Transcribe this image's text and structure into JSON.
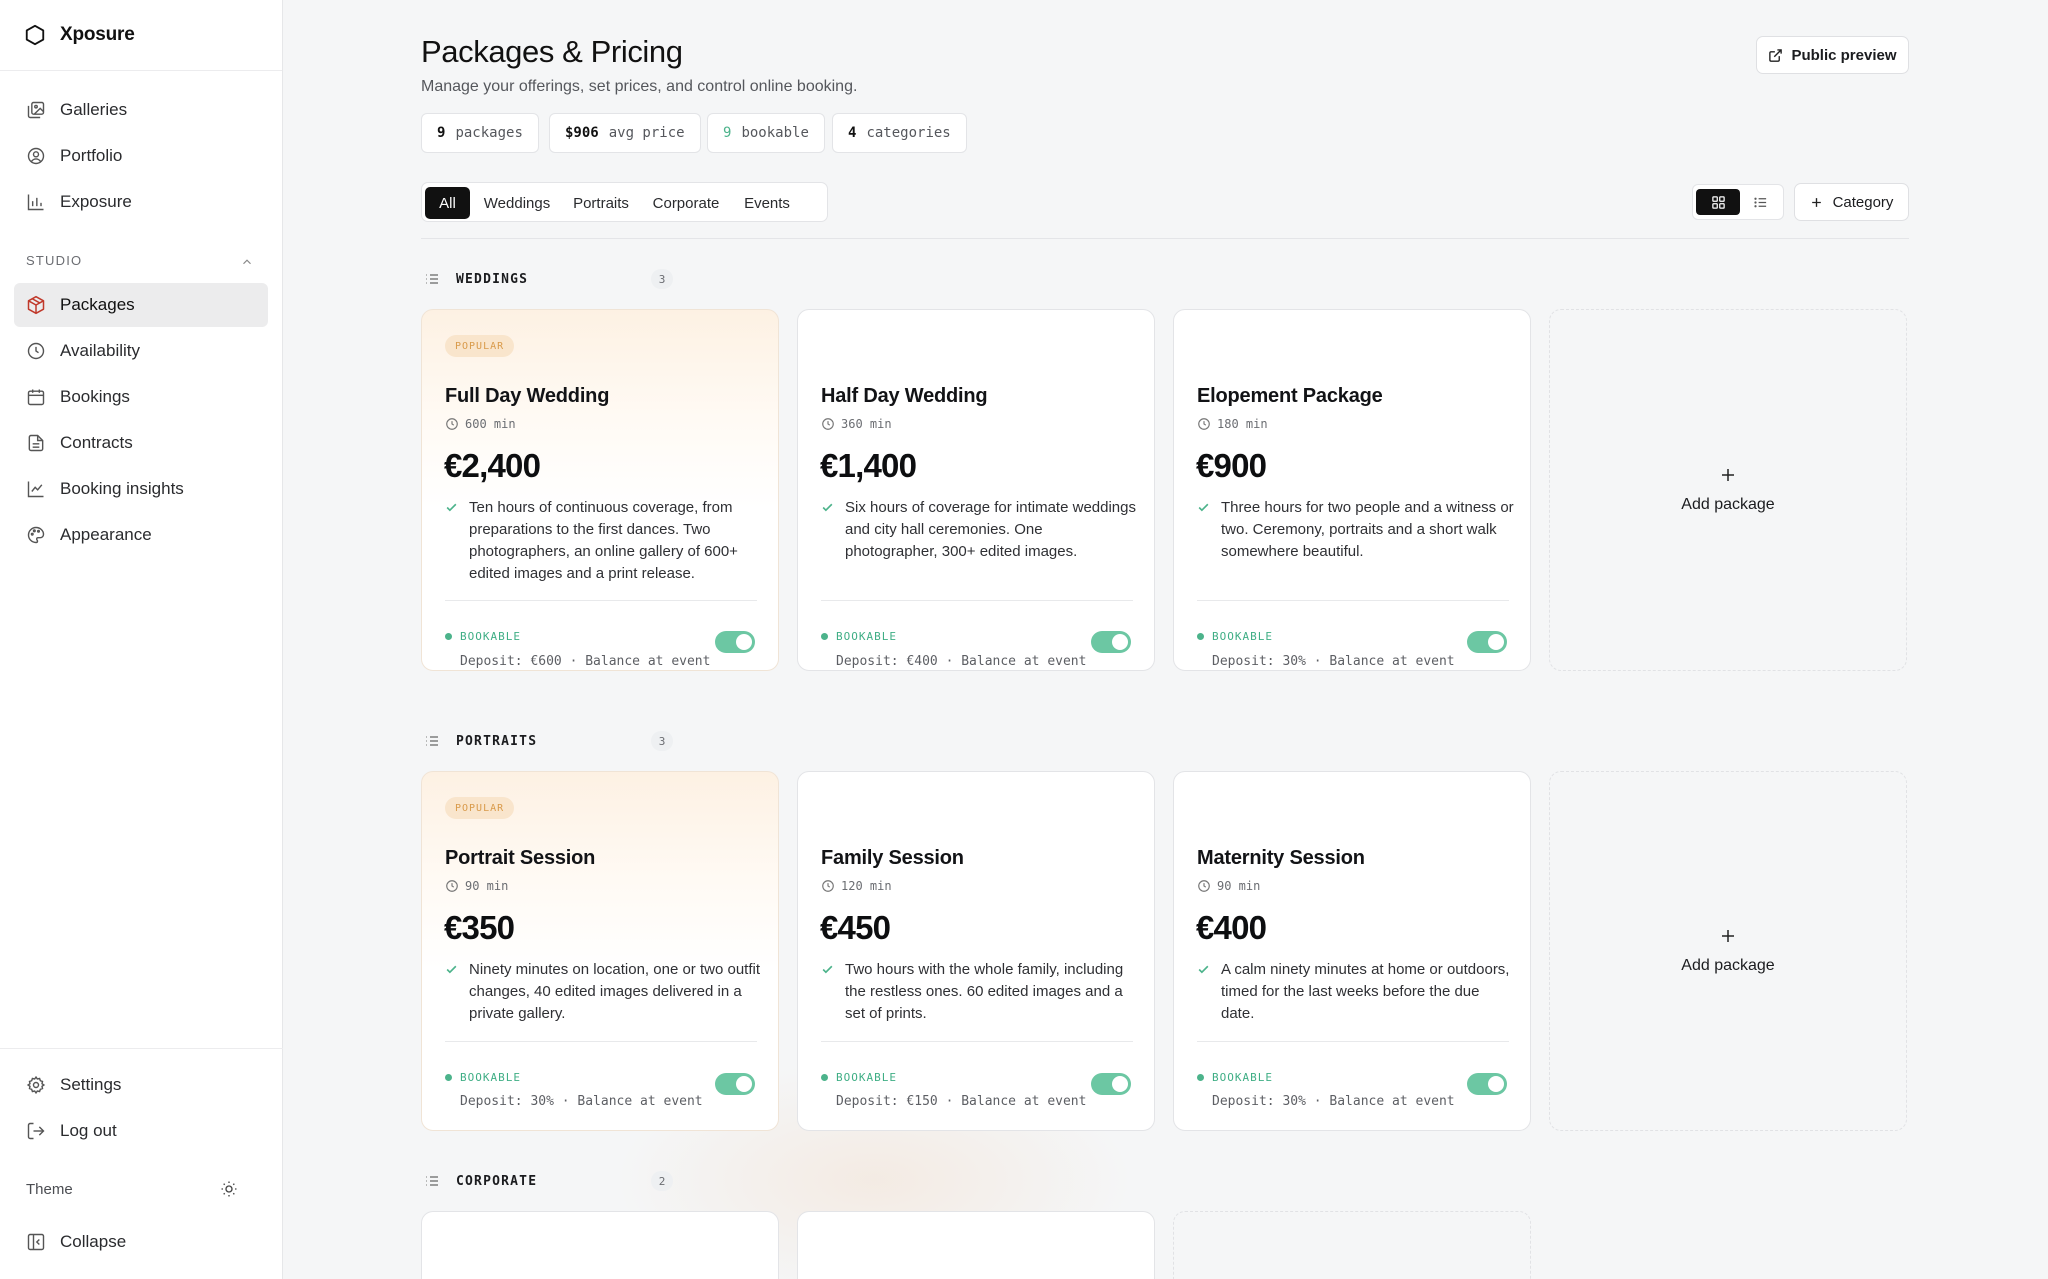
{
  "app": {
    "name": "Xposure"
  },
  "sidebar": {
    "top_items": [
      {
        "label": "Galleries",
        "icon": "gallery-icon"
      },
      {
        "label": "Portfolio",
        "icon": "user-circle-icon"
      },
      {
        "label": "Exposure",
        "icon": "bar-chart-icon"
      }
    ],
    "section_label": "STUDIO",
    "studio_items": [
      {
        "label": "Packages",
        "icon": "package-icon",
        "active": true
      },
      {
        "label": "Availability",
        "icon": "clock-icon"
      },
      {
        "label": "Bookings",
        "icon": "calendar-icon"
      },
      {
        "label": "Contracts",
        "icon": "document-icon"
      },
      {
        "label": "Booking insights",
        "icon": "line-chart-icon"
      },
      {
        "label": "Appearance",
        "icon": "palette-icon"
      }
    ],
    "bottom_items": [
      {
        "label": "Settings",
        "icon": "gear-icon"
      },
      {
        "label": "Log out",
        "icon": "logout-icon"
      }
    ],
    "theme_label": "Theme",
    "collapse_label": "Collapse"
  },
  "header": {
    "title": "Packages & Pricing",
    "subtitle": "Manage your offerings, set prices, and control online booking.",
    "preview_button": "Public preview"
  },
  "stats": [
    {
      "value": "9",
      "label": "packages"
    },
    {
      "value": "$906",
      "label": "avg price"
    },
    {
      "value": "9",
      "label": "bookable"
    },
    {
      "value": "4",
      "label": "categories"
    }
  ],
  "tabs": [
    "All",
    "Weddings",
    "Portraits",
    "Corporate",
    "Events"
  ],
  "active_tab": "All",
  "category_button": "Category",
  "add_package_label": "Add package",
  "colors": {
    "accent_green": "#4cb38b",
    "popular_badge": "#d99a4a",
    "dark": "#111111"
  },
  "categories": [
    {
      "name": "WEDDINGS",
      "count": "3",
      "packages": [
        {
          "badge": "POPULAR",
          "title": "Full Day Wedding",
          "duration": "600 min",
          "price": "€2,400",
          "description": "Ten hours of continuous coverage, from preparations to the first dances. Two photographers, an online gallery of 600+ edited images and a print release.",
          "status": "BOOKABLE",
          "deposit": "Deposit: €600 · Balance at event"
        },
        {
          "badge": "",
          "title": "Half Day Wedding",
          "duration": "360 min",
          "price": "€1,400",
          "description": "Six hours of coverage for intimate weddings and city hall ceremonies. One photographer, 300+ edited images.",
          "status": "BOOKABLE",
          "deposit": "Deposit: €400 · Balance at event"
        },
        {
          "badge": "",
          "title": "Elopement Package",
          "duration": "180 min",
          "price": "€900",
          "description": "Three hours for two people and a witness or two. Ceremony, portraits and a short walk somewhere beautiful.",
          "status": "BOOKABLE",
          "deposit": "Deposit: 30% · Balance at event"
        }
      ]
    },
    {
      "name": "PORTRAITS",
      "count": "3",
      "packages": [
        {
          "badge": "POPULAR",
          "title": "Portrait Session",
          "duration": "90 min",
          "price": "€350",
          "description": "Ninety minutes on location, one or two outfit changes, 40 edited images delivered in a private gallery.",
          "status": "BOOKABLE",
          "deposit": "Deposit: 30% · Balance at event"
        },
        {
          "badge": "",
          "title": "Family Session",
          "duration": "120 min",
          "price": "€450",
          "description": "Two hours with the whole family, including the restless ones. 60 edited images and a set of prints.",
          "status": "BOOKABLE",
          "deposit": "Deposit: €150 · Balance at event"
        },
        {
          "badge": "",
          "title": "Maternity Session",
          "duration": "90 min",
          "price": "€400",
          "description": "A calm ninety minutes at home or outdoors, timed for the last weeks before the due date.",
          "status": "BOOKABLE",
          "deposit": "Deposit: 30% · Balance at event"
        }
      ]
    },
    {
      "name": "CORPORATE",
      "count": "2"
    }
  ]
}
